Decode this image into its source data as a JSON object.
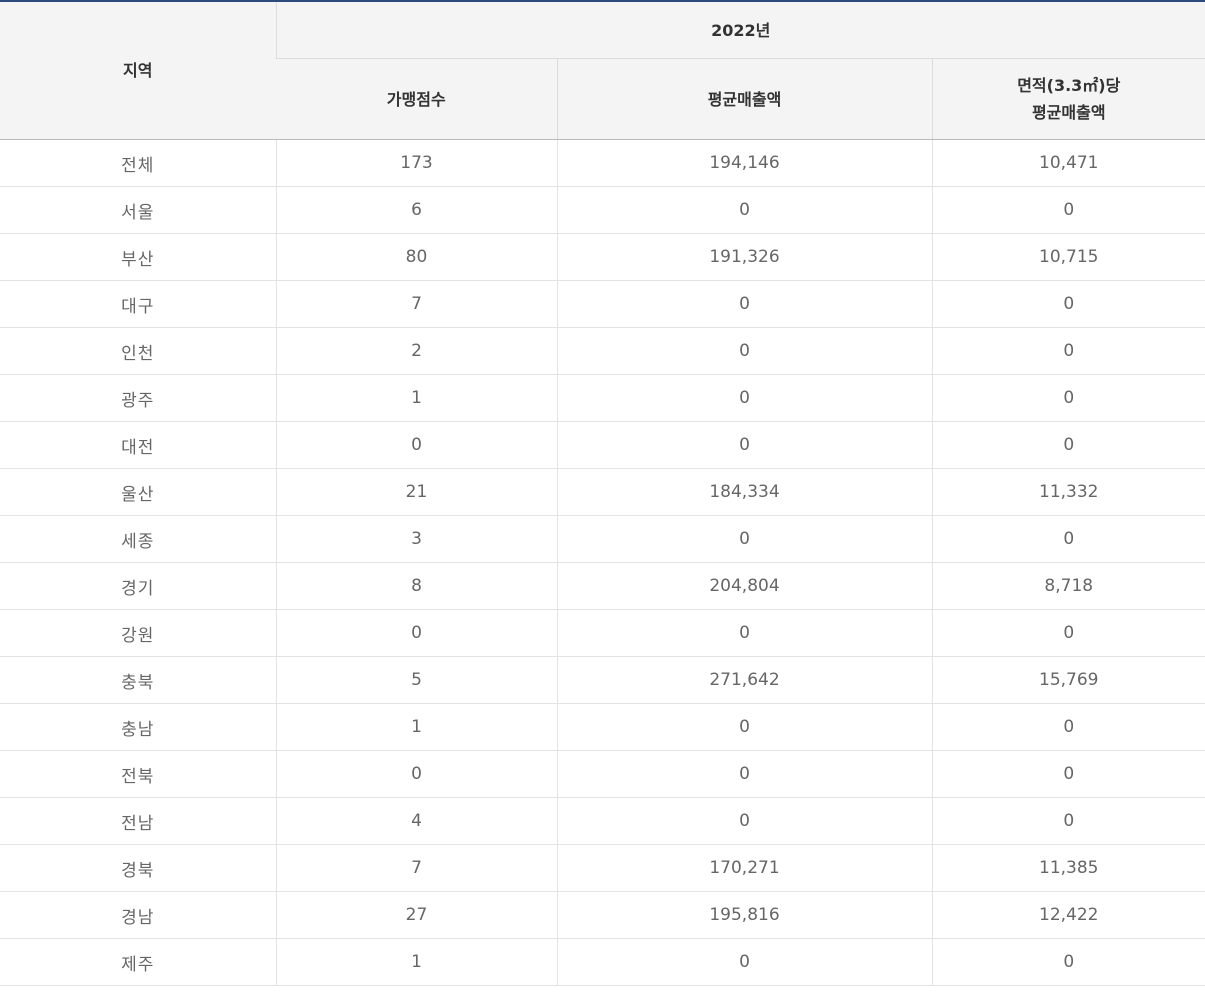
{
  "table": {
    "headers": {
      "region": "지역",
      "year": "2022년",
      "store_count": "가맹점수",
      "avg_sales": "평균매출액",
      "area_sales_line1": "면적(3.3㎡)당",
      "area_sales_line2": "평균매출액"
    },
    "rows": [
      {
        "region": "전체",
        "store_count": "173",
        "avg_sales": "194,146",
        "area_sales": "10,471"
      },
      {
        "region": "서울",
        "store_count": "6",
        "avg_sales": "0",
        "area_sales": "0"
      },
      {
        "region": "부산",
        "store_count": "80",
        "avg_sales": "191,326",
        "area_sales": "10,715"
      },
      {
        "region": "대구",
        "store_count": "7",
        "avg_sales": "0",
        "area_sales": "0"
      },
      {
        "region": "인천",
        "store_count": "2",
        "avg_sales": "0",
        "area_sales": "0"
      },
      {
        "region": "광주",
        "store_count": "1",
        "avg_sales": "0",
        "area_sales": "0"
      },
      {
        "region": "대전",
        "store_count": "0",
        "avg_sales": "0",
        "area_sales": "0"
      },
      {
        "region": "울산",
        "store_count": "21",
        "avg_sales": "184,334",
        "area_sales": "11,332"
      },
      {
        "region": "세종",
        "store_count": "3",
        "avg_sales": "0",
        "area_sales": "0"
      },
      {
        "region": "경기",
        "store_count": "8",
        "avg_sales": "204,804",
        "area_sales": "8,718"
      },
      {
        "region": "강원",
        "store_count": "0",
        "avg_sales": "0",
        "area_sales": "0"
      },
      {
        "region": "충북",
        "store_count": "5",
        "avg_sales": "271,642",
        "area_sales": "15,769"
      },
      {
        "region": "충남",
        "store_count": "1",
        "avg_sales": "0",
        "area_sales": "0"
      },
      {
        "region": "전북",
        "store_count": "0",
        "avg_sales": "0",
        "area_sales": "0"
      },
      {
        "region": "전남",
        "store_count": "4",
        "avg_sales": "0",
        "area_sales": "0"
      },
      {
        "region": "경북",
        "store_count": "7",
        "avg_sales": "170,271",
        "area_sales": "11,385"
      },
      {
        "region": "경남",
        "store_count": "27",
        "avg_sales": "195,816",
        "area_sales": "12,422"
      },
      {
        "region": "제주",
        "store_count": "1",
        "avg_sales": "0",
        "area_sales": "0"
      }
    ]
  },
  "colors": {
    "top_border": "#2d4a7a",
    "header_bg": "#f4f4f4",
    "header_text": "#333333",
    "cell_text": "#666666",
    "grid_line": "#e3e3e3"
  }
}
